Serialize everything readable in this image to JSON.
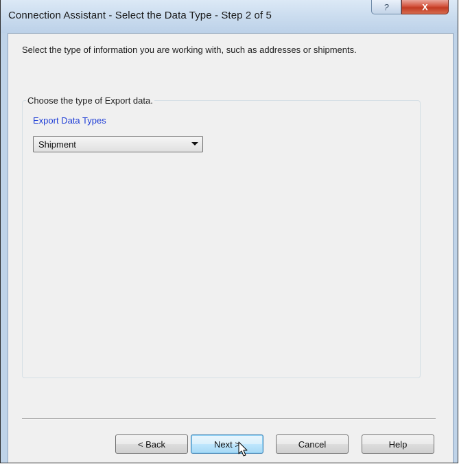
{
  "window": {
    "title": "Connection Assistant - Select the Data Type - Step 2 of 5",
    "help_caption": "?",
    "close_caption": "X"
  },
  "main": {
    "instruction": "Select the type of information you are working with, such as addresses or shipments.",
    "group_label": "Choose the type of Export data.",
    "field_label": "Export Data Types",
    "dropdown": {
      "selected": "Shipment"
    }
  },
  "buttons": {
    "back": "< Back",
    "next": "Next >",
    "cancel": "Cancel",
    "help": "Help"
  },
  "icons": {
    "dropdown": "chevron-down-icon",
    "cursor": "mouse-pointer-icon"
  },
  "colors": {
    "field_label": "#1f3ed6",
    "close_button": "#c23a22",
    "default_button": "#bee6fd"
  }
}
